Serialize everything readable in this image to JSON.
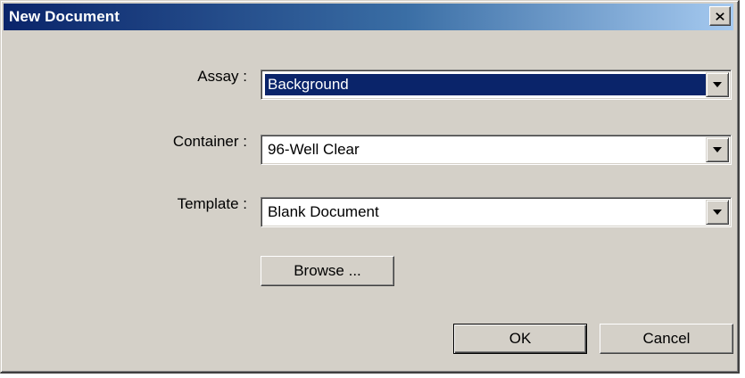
{
  "window": {
    "title": "New Document"
  },
  "form": {
    "assay": {
      "label": "Assay :",
      "value": "Background"
    },
    "container": {
      "label": "Container :",
      "value": "96-Well Clear"
    },
    "template": {
      "label": "Template :",
      "value": "Blank Document"
    }
  },
  "buttons": {
    "browse": "Browse ...",
    "ok": "OK",
    "cancel": "Cancel"
  },
  "colors": {
    "titlebar_start": "#0a246a",
    "titlebar_end": "#a6caf0",
    "face": "#d4d0c8",
    "selection": "#0a246a"
  }
}
